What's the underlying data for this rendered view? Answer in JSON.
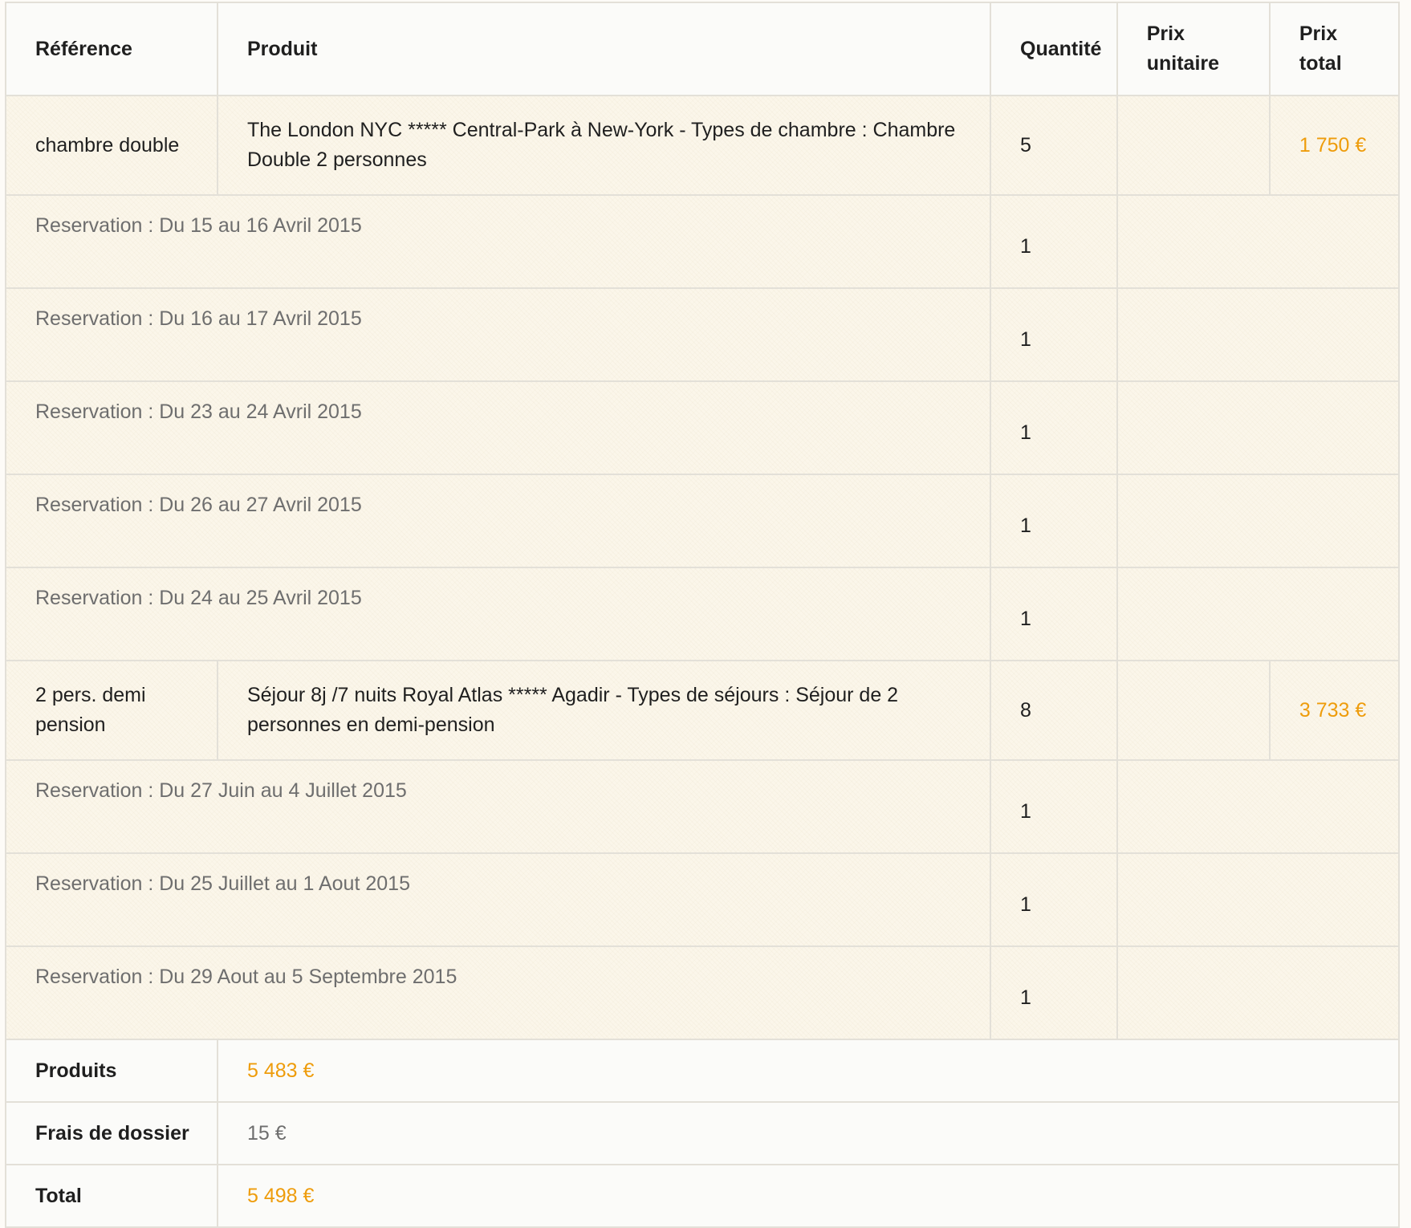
{
  "headers": {
    "reference": "Référence",
    "product": "Produit",
    "quantity": "Quantité",
    "unit_price_line1": "Prix",
    "unit_price_line2": "unitaire",
    "total_price_line1": "Prix",
    "total_price_line2": "total"
  },
  "items": [
    {
      "reference": "chambre double",
      "product": "The London NYC ***** Central-Park à New-York - Types de chambre : Chambre Double 2 personnes",
      "quantity": "5",
      "unit_price": "",
      "total_price": "1 750 €",
      "reservations": [
        {
          "label": "Reservation : Du 15 au 16 Avril 2015",
          "quantity": "1"
        },
        {
          "label": "Reservation : Du 16 au 17 Avril 2015",
          "quantity": "1"
        },
        {
          "label": "Reservation : Du 23 au 24 Avril 2015",
          "quantity": "1"
        },
        {
          "label": "Reservation : Du 26 au 27 Avril 2015",
          "quantity": "1"
        },
        {
          "label": "Reservation : Du 24 au 25 Avril 2015",
          "quantity": "1"
        }
      ]
    },
    {
      "reference": "2 pers. demi pension",
      "product": "Séjour 8j /7 nuits Royal Atlas ***** Agadir - Types de séjours : Séjour de 2 personnes en demi-pension",
      "quantity": "8",
      "unit_price": "",
      "total_price": "3 733 €",
      "reservations": [
        {
          "label": "Reservation : Du 27 Juin au 4 Juillet 2015",
          "quantity": "1"
        },
        {
          "label": "Reservation : Du 25 Juillet au 1 Aout 2015",
          "quantity": "1"
        },
        {
          "label": "Reservation : Du 29 Aout au 5 Septembre 2015",
          "quantity": "1"
        }
      ]
    }
  ],
  "summary": {
    "products_label": "Produits",
    "products_value": "5 483 €",
    "fees_label": "Frais de dossier",
    "fees_value": "15 €",
    "total_label": "Total",
    "total_value": "5 498 €"
  },
  "colors": {
    "price_accent": "#ee9c0b",
    "border": "#e3e0d8",
    "muted_text": "#6e6e6e"
  }
}
